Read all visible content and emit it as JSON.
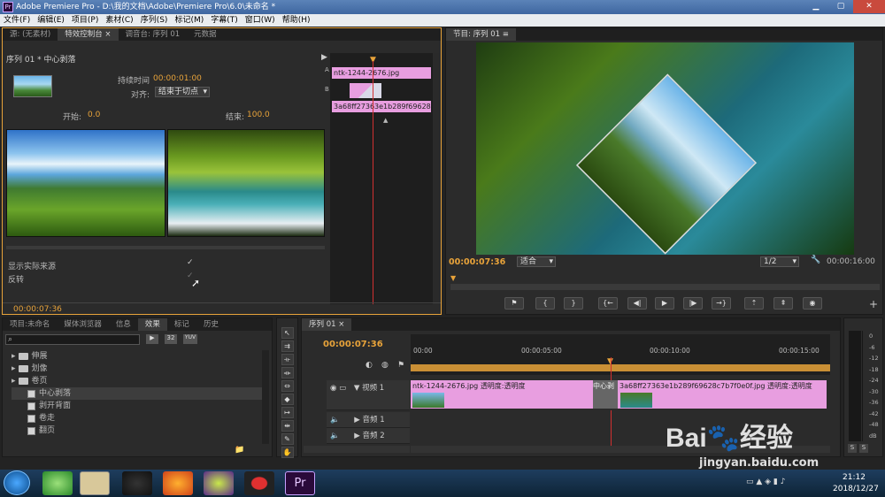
{
  "window": {
    "title": "Adobe Premiere Pro - D:\\我的文档\\Adobe\\Premiere Pro\\6.0\\未命名 *",
    "app_icon": "Pr"
  },
  "menu": [
    "文件(F)",
    "编辑(E)",
    "项目(P)",
    "素材(C)",
    "序列(S)",
    "标记(M)",
    "字幕(T)",
    "窗口(W)",
    "帮助(H)"
  ],
  "source_tabs": {
    "source": "源: (无素材)",
    "effect_controls": "特效控制台",
    "mixer": "调音台: 序列 01",
    "metadata": "元数据"
  },
  "effect_controls": {
    "header": "序列 01 * 中心剥落",
    "duration_label": "持续时间",
    "duration_value": "00:00:01:00",
    "align_label": "对齐:",
    "align_value": "结束于切点",
    "start_label": "开始:",
    "start_value": "0.0",
    "end_label": "结束:",
    "end_value": "100.0",
    "show_source_label": "显示实际来源",
    "reverse_label": "反转",
    "timecode": "00:00:07:36",
    "mini_clip_a": "ntk-1244-2676.jpg",
    "mini_clip_b": "3a68ff27363e1b289f69628c7b7f0e0f.jpg"
  },
  "program": {
    "tab": "节目: 序列 01",
    "timecode": "00:00:07:36",
    "fit": "适合",
    "quality": "1/2",
    "duration": "00:00:16:00"
  },
  "project": {
    "tabs": [
      "项目:未命名",
      "媒体浏览器",
      "信息",
      "效果",
      "标记",
      "历史"
    ],
    "active_tab": "效果",
    "badges": [
      "32",
      "YUV"
    ],
    "tree": [
      {
        "type": "folder",
        "label": "伸展"
      },
      {
        "type": "folder",
        "label": "划像"
      },
      {
        "type": "folder",
        "label": "卷页"
      },
      {
        "type": "effect",
        "label": "中心剥落",
        "selected": true
      },
      {
        "type": "effect",
        "label": "剥开背面"
      },
      {
        "type": "effect",
        "label": "卷走"
      },
      {
        "type": "effect",
        "label": "翻页"
      }
    ]
  },
  "timeline": {
    "tab": "序列 01",
    "timecode": "00:00:07:36",
    "ruler": [
      "00:00",
      "00:00:05:00",
      "00:00:10:00",
      "00:00:15:00"
    ],
    "video_track": "视频 1",
    "audio_tracks": [
      "音频 1",
      "音频 2"
    ],
    "clip1_name": "ntk-1244-2676.jpg",
    "clip1_fx": "透明度:透明度",
    "transition": "中心剥",
    "clip2_name": "3a68ff27363e1b289f69628c7b7f0e0f.jpg",
    "clip2_fx": "透明度:透明度"
  },
  "meter": {
    "labels": [
      "0",
      "-6",
      "-12",
      "-18",
      "-24",
      "-30",
      "-36",
      "-42",
      "-48",
      "dB"
    ],
    "solo": [
      "S",
      "S"
    ]
  },
  "taskbar": {
    "time": "21:12",
    "date": "2018/12/27"
  },
  "watermark": {
    "brand": "Bai",
    "brand2": "经验",
    "url": "jingyan.baidu.com"
  },
  "colors": {
    "accent": "#e8a33a",
    "clip": "#e89ee0",
    "playhead": "#d23030",
    "titlebar": "#4a72ab"
  }
}
